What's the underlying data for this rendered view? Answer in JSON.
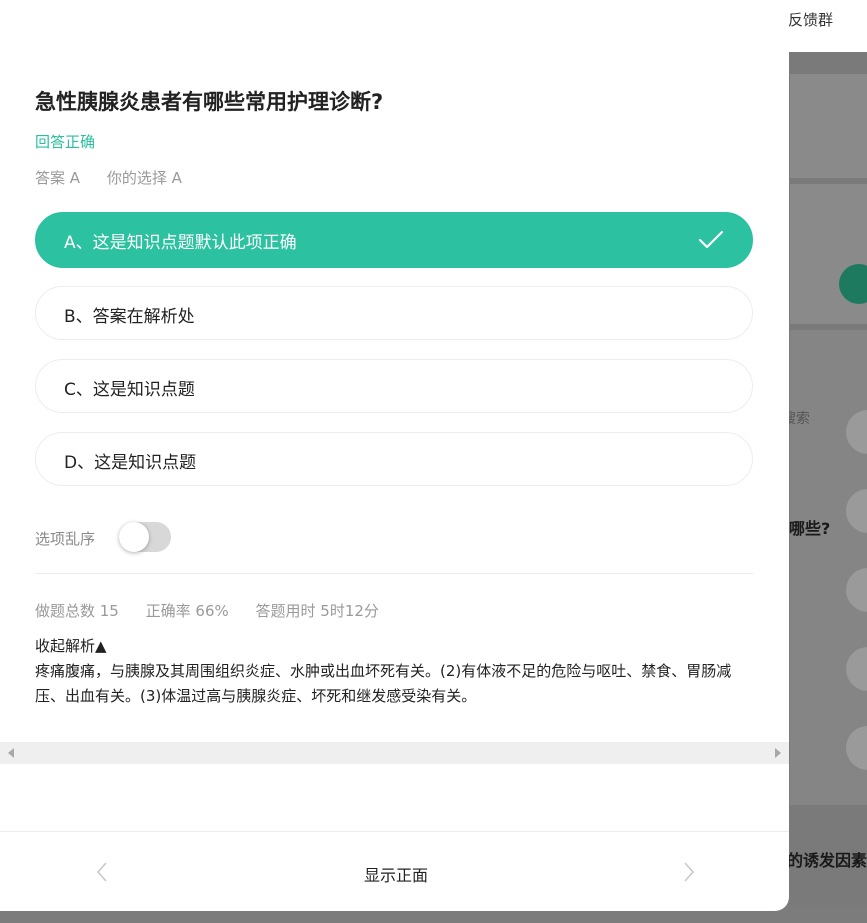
{
  "background": {
    "topbar_text": "反馈群",
    "search_text": "搜索",
    "question_snippet_1": "哪些?",
    "question_snippet_2": "的诱发因素"
  },
  "question": {
    "title": "急性胰腺炎患者有哪些常用护理诊断?",
    "result": "回答正确",
    "answer": "答案 A",
    "your_choice": "你的选择 A"
  },
  "options": [
    {
      "label": "A、这是知识点题默认此项正确",
      "correct": true
    },
    {
      "label": "B、答案在解析处",
      "correct": false
    },
    {
      "label": "C、这是知识点题",
      "correct": false
    },
    {
      "label": "D、这是知识点题",
      "correct": false
    }
  ],
  "shuffle": {
    "label": "选项乱序",
    "enabled": false
  },
  "stats": {
    "total": "做题总数 15",
    "accuracy": "正确率 66%",
    "time": "答题用时 5时12分"
  },
  "explanation": {
    "toggle_label": "收起解析▲",
    "text": "疼痛腹痛，与胰腺及其周围组织炎症、水肿或出血坏死有关。(2)有体液不足的危险与呕吐、禁食、胃肠减压、出血有关。(3)体温过高与胰腺炎症、坏死和继发感受染有关。"
  },
  "footer": {
    "center_label": "显示正面"
  },
  "colors": {
    "accent": "#2bc1a1",
    "result": "#2bbf9f"
  }
}
